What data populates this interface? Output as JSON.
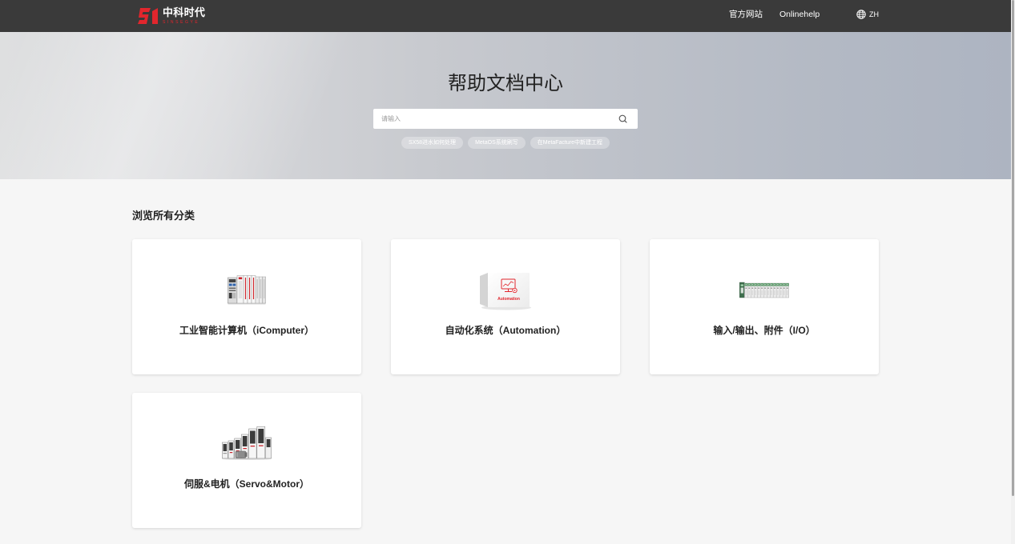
{
  "header": {
    "logo": {
      "icon": "logo-mark-icon",
      "text": "中科时代",
      "subtext": "SINSEGYE"
    },
    "nav": [
      {
        "label": "官方网站"
      },
      {
        "label": "Onlinehelp"
      }
    ],
    "language": {
      "icon": "globe-icon",
      "label": "ZH"
    }
  },
  "hero": {
    "title": "帮助文档中心",
    "search": {
      "placeholder": "请输入",
      "icon": "search-icon"
    },
    "tags": [
      {
        "label": "SX58进水如何处理"
      },
      {
        "label": "MetaOS系统刷写"
      },
      {
        "label": "在MetaFacture中新建工程"
      }
    ]
  },
  "main": {
    "section_title": "浏览所有分类",
    "categories": [
      {
        "label": "工业智能计算机（iComputer）",
        "image": "icomputer-product-image"
      },
      {
        "label": "自动化系统（Automation）",
        "image": "automation-box-image",
        "image_text": "Automation"
      },
      {
        "label": "输入/输出、附件（I/O）",
        "image": "io-modules-image"
      },
      {
        "label": "伺服&电机（Servo&Motor）",
        "image": "servo-motor-image"
      }
    ]
  },
  "colors": {
    "brand_red": "#e1262d",
    "nav_bg": "#3a3a3a",
    "page_bg": "#f6f6f6",
    "title_text": "#222222"
  }
}
